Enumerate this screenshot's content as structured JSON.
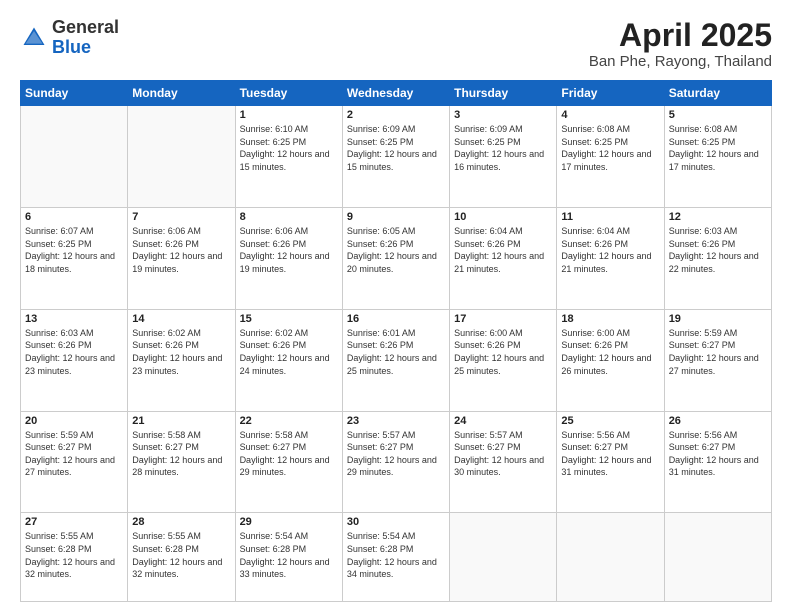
{
  "header": {
    "logo_general": "General",
    "logo_blue": "Blue",
    "month_title": "April 2025",
    "location": "Ban Phe, Rayong, Thailand"
  },
  "weekdays": [
    "Sunday",
    "Monday",
    "Tuesday",
    "Wednesday",
    "Thursday",
    "Friday",
    "Saturday"
  ],
  "weeks": [
    [
      {
        "day": "",
        "info": ""
      },
      {
        "day": "",
        "info": ""
      },
      {
        "day": "1",
        "info": "Sunrise: 6:10 AM\nSunset: 6:25 PM\nDaylight: 12 hours and 15 minutes."
      },
      {
        "day": "2",
        "info": "Sunrise: 6:09 AM\nSunset: 6:25 PM\nDaylight: 12 hours and 15 minutes."
      },
      {
        "day": "3",
        "info": "Sunrise: 6:09 AM\nSunset: 6:25 PM\nDaylight: 12 hours and 16 minutes."
      },
      {
        "day": "4",
        "info": "Sunrise: 6:08 AM\nSunset: 6:25 PM\nDaylight: 12 hours and 17 minutes."
      },
      {
        "day": "5",
        "info": "Sunrise: 6:08 AM\nSunset: 6:25 PM\nDaylight: 12 hours and 17 minutes."
      }
    ],
    [
      {
        "day": "6",
        "info": "Sunrise: 6:07 AM\nSunset: 6:25 PM\nDaylight: 12 hours and 18 minutes."
      },
      {
        "day": "7",
        "info": "Sunrise: 6:06 AM\nSunset: 6:26 PM\nDaylight: 12 hours and 19 minutes."
      },
      {
        "day": "8",
        "info": "Sunrise: 6:06 AM\nSunset: 6:26 PM\nDaylight: 12 hours and 19 minutes."
      },
      {
        "day": "9",
        "info": "Sunrise: 6:05 AM\nSunset: 6:26 PM\nDaylight: 12 hours and 20 minutes."
      },
      {
        "day": "10",
        "info": "Sunrise: 6:04 AM\nSunset: 6:26 PM\nDaylight: 12 hours and 21 minutes."
      },
      {
        "day": "11",
        "info": "Sunrise: 6:04 AM\nSunset: 6:26 PM\nDaylight: 12 hours and 21 minutes."
      },
      {
        "day": "12",
        "info": "Sunrise: 6:03 AM\nSunset: 6:26 PM\nDaylight: 12 hours and 22 minutes."
      }
    ],
    [
      {
        "day": "13",
        "info": "Sunrise: 6:03 AM\nSunset: 6:26 PM\nDaylight: 12 hours and 23 minutes."
      },
      {
        "day": "14",
        "info": "Sunrise: 6:02 AM\nSunset: 6:26 PM\nDaylight: 12 hours and 23 minutes."
      },
      {
        "day": "15",
        "info": "Sunrise: 6:02 AM\nSunset: 6:26 PM\nDaylight: 12 hours and 24 minutes."
      },
      {
        "day": "16",
        "info": "Sunrise: 6:01 AM\nSunset: 6:26 PM\nDaylight: 12 hours and 25 minutes."
      },
      {
        "day": "17",
        "info": "Sunrise: 6:00 AM\nSunset: 6:26 PM\nDaylight: 12 hours and 25 minutes."
      },
      {
        "day": "18",
        "info": "Sunrise: 6:00 AM\nSunset: 6:26 PM\nDaylight: 12 hours and 26 minutes."
      },
      {
        "day": "19",
        "info": "Sunrise: 5:59 AM\nSunset: 6:27 PM\nDaylight: 12 hours and 27 minutes."
      }
    ],
    [
      {
        "day": "20",
        "info": "Sunrise: 5:59 AM\nSunset: 6:27 PM\nDaylight: 12 hours and 27 minutes."
      },
      {
        "day": "21",
        "info": "Sunrise: 5:58 AM\nSunset: 6:27 PM\nDaylight: 12 hours and 28 minutes."
      },
      {
        "day": "22",
        "info": "Sunrise: 5:58 AM\nSunset: 6:27 PM\nDaylight: 12 hours and 29 minutes."
      },
      {
        "day": "23",
        "info": "Sunrise: 5:57 AM\nSunset: 6:27 PM\nDaylight: 12 hours and 29 minutes."
      },
      {
        "day": "24",
        "info": "Sunrise: 5:57 AM\nSunset: 6:27 PM\nDaylight: 12 hours and 30 minutes."
      },
      {
        "day": "25",
        "info": "Sunrise: 5:56 AM\nSunset: 6:27 PM\nDaylight: 12 hours and 31 minutes."
      },
      {
        "day": "26",
        "info": "Sunrise: 5:56 AM\nSunset: 6:27 PM\nDaylight: 12 hours and 31 minutes."
      }
    ],
    [
      {
        "day": "27",
        "info": "Sunrise: 5:55 AM\nSunset: 6:28 PM\nDaylight: 12 hours and 32 minutes."
      },
      {
        "day": "28",
        "info": "Sunrise: 5:55 AM\nSunset: 6:28 PM\nDaylight: 12 hours and 32 minutes."
      },
      {
        "day": "29",
        "info": "Sunrise: 5:54 AM\nSunset: 6:28 PM\nDaylight: 12 hours and 33 minutes."
      },
      {
        "day": "30",
        "info": "Sunrise: 5:54 AM\nSunset: 6:28 PM\nDaylight: 12 hours and 34 minutes."
      },
      {
        "day": "",
        "info": ""
      },
      {
        "day": "",
        "info": ""
      },
      {
        "day": "",
        "info": ""
      }
    ]
  ]
}
